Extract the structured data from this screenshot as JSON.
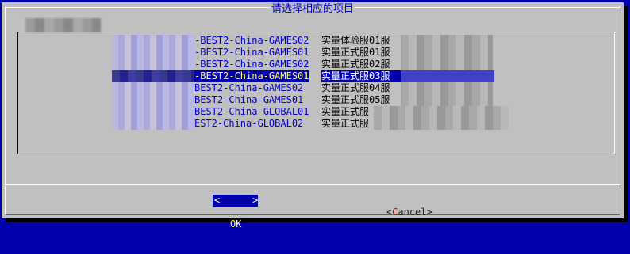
{
  "dialog": {
    "title": "请选择相应的项目",
    "prompt": ""
  },
  "menu": {
    "items": [
      {
        "name": "-BEST2-China-GAMES02",
        "desc": "实量体验服01服"
      },
      {
        "name": "-BEST2-China-GAMES01",
        "desc": "实量正式服01服"
      },
      {
        "name": "-BEST2-China-GAMES02",
        "desc": "实量正式服02服"
      },
      {
        "name": "-BEST2-China-GAMES01",
        "desc": "实量正式服03服",
        "selected": true
      },
      {
        "name": "BEST2-China-GAMES02",
        "desc": "实量正式服04服"
      },
      {
        "name": "BEST2-China-GAMES01",
        "desc": "实量正式服05服"
      },
      {
        "name": "BEST2-China-GLOBAL01",
        "desc": "实量正式服"
      },
      {
        "name": "EST2-China-GLOBAL02",
        "desc": "实量正式服"
      }
    ]
  },
  "buttons": {
    "ok_left": "<",
    "ok_hot": "O",
    "ok_rest": "K",
    "ok_right": ">",
    "cancel_left": "<",
    "cancel_hot": "C",
    "cancel_rest": "ancel",
    "cancel_right": ">"
  }
}
